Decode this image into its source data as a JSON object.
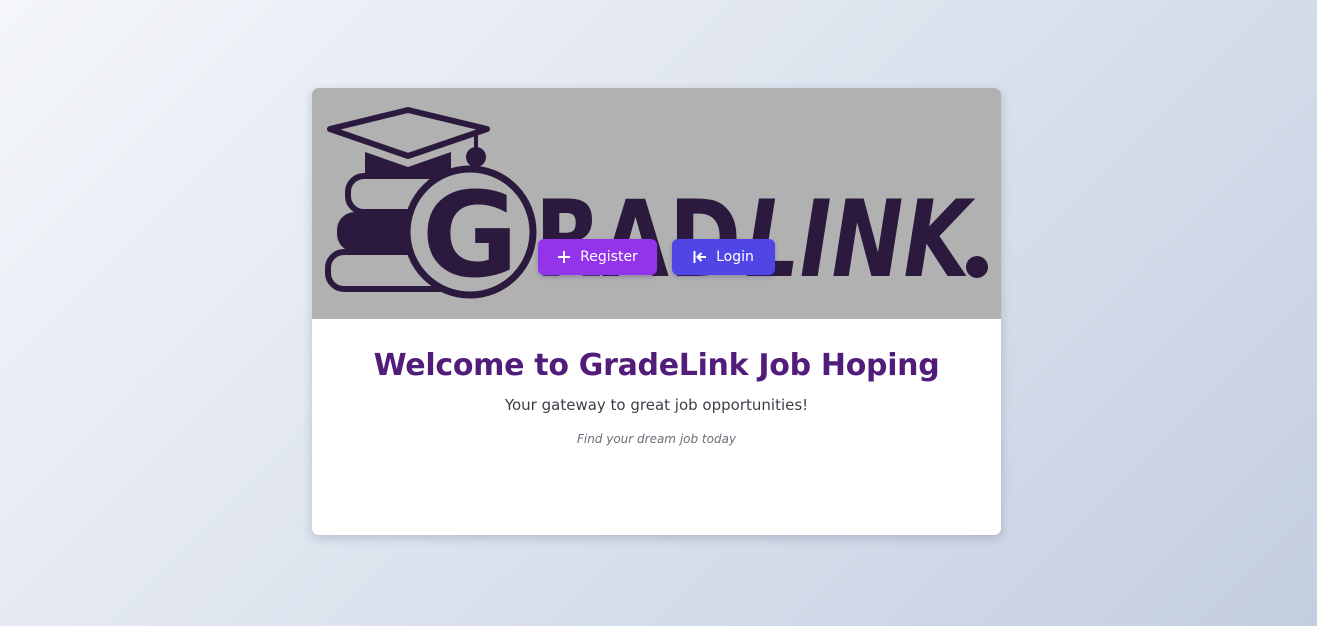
{
  "logo": {
    "alt_text": "GRADLINK."
  },
  "welcome": {
    "title": "Welcome to GradeLink Job Hoping",
    "subtitle": "Your gateway to great job opportunities!",
    "tagline": "Find your dream job today"
  },
  "actions": {
    "register_label": "Register",
    "register_icon": "plus-icon",
    "login_label": "Login",
    "login_icon": "login-arrow-icon"
  },
  "colors": {
    "title": "#521c7a",
    "register_button": "#9333ea",
    "login_button": "#4f46e5",
    "banner_background": "#b1b1b1",
    "logo_ink": "#2c1a3e"
  }
}
